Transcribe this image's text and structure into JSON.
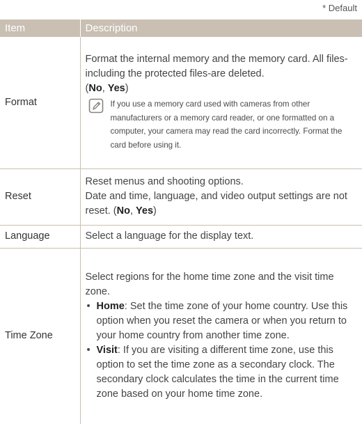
{
  "default_note": "* Default",
  "header": {
    "item": "Item",
    "description": "Description"
  },
  "rows": {
    "format": {
      "item": "Format",
      "desc_line": "Format the internal memory and the memory card. All files-including the protected files-are deleted.",
      "opt_no": "No",
      "opt_yes": "Yes",
      "note": "If you use a memory card used with cameras from other manufacturers or a memory card reader, or one formatted on a computer, your camera may read the card incorrectly. Format the card before using it.",
      "note_icon": "note-pencil-icon"
    },
    "reset": {
      "item": "Reset",
      "desc_line1": "Reset menus and shooting options.",
      "desc_line2": "Date and time, language, and video output settings are not reset.",
      "opt_no": "No",
      "opt_yes": "Yes"
    },
    "language": {
      "item": "Language",
      "desc": "Select a language for the display text."
    },
    "timezone": {
      "item": "Time Zone",
      "desc": "Select regions for the home time zone and the visit time zone.",
      "home_label": "Home",
      "home_text": ": Set the time zone of your home country. Use this option when you reset the camera or when you return to your home country from another time zone.",
      "visit_label": "Visit",
      "visit_text": ": If you are visiting a different time zone, use this option to set the time zone as a secondary clock. The secondary clock calculates the time in the current time zone based on your home time zone."
    }
  },
  "colors": {
    "header_bg": "#c9bfb2",
    "border": "#c9bfb2"
  }
}
